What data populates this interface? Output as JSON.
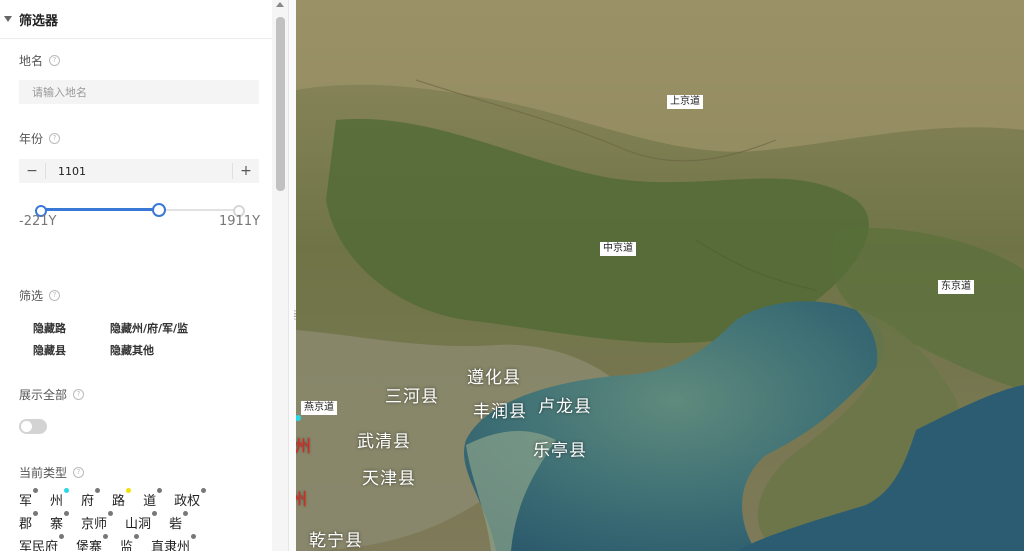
{
  "panel": {
    "title": "筛选器",
    "place": {
      "label": "地名",
      "placeholder": "请输入地名",
      "value": ""
    },
    "year": {
      "label": "年份",
      "value": "1101",
      "minus": "−",
      "plus": "+",
      "min_label": "-221Y",
      "max_label": "1911Y",
      "slider_fraction": 0.6
    },
    "filter": {
      "label": "筛选",
      "options": [
        "隐藏路",
        "隐藏州/府/军/监",
        "隐藏县",
        "隐藏其他"
      ]
    },
    "show_all": {
      "label": "展示全部",
      "on": false
    },
    "types": {
      "label": "当前类型",
      "items": [
        {
          "name": "军",
          "dot": "#777777"
        },
        {
          "name": "州",
          "dot": "#2ad7e8"
        },
        {
          "name": "府",
          "dot": "#777777"
        },
        {
          "name": "路",
          "dot": "#f2e20b"
        },
        {
          "name": "道",
          "dot": "#777777"
        },
        {
          "name": "政权",
          "dot": "#777777"
        },
        {
          "name": "郡",
          "dot": "#777777"
        },
        {
          "name": "寨",
          "dot": "#777777"
        },
        {
          "name": "京师",
          "dot": "#777777"
        },
        {
          "name": "山洞",
          "dot": "#777777"
        },
        {
          "name": "砦",
          "dot": "#777777"
        },
        {
          "name": "军民府",
          "dot": "#777777"
        },
        {
          "name": "堡寨",
          "dot": "#777777"
        },
        {
          "name": "监",
          "dot": "#777777"
        },
        {
          "name": "直隶州",
          "dot": "#777777"
        }
      ]
    }
  },
  "map": {
    "dao_labels": [
      "上京道",
      "中京道",
      "东京道",
      "燕京道"
    ],
    "county_labels": [
      "遵化县",
      "三河县",
      "丰润县",
      "卢龙县",
      "武清县",
      "乐亭县",
      "天津县",
      "乾宁县"
    ],
    "red_fragments": [
      "州",
      "州"
    ],
    "colors": {
      "accent": "#3a78d8",
      "sea": "#2f5f6f",
      "land": "#7b7a52"
    }
  }
}
